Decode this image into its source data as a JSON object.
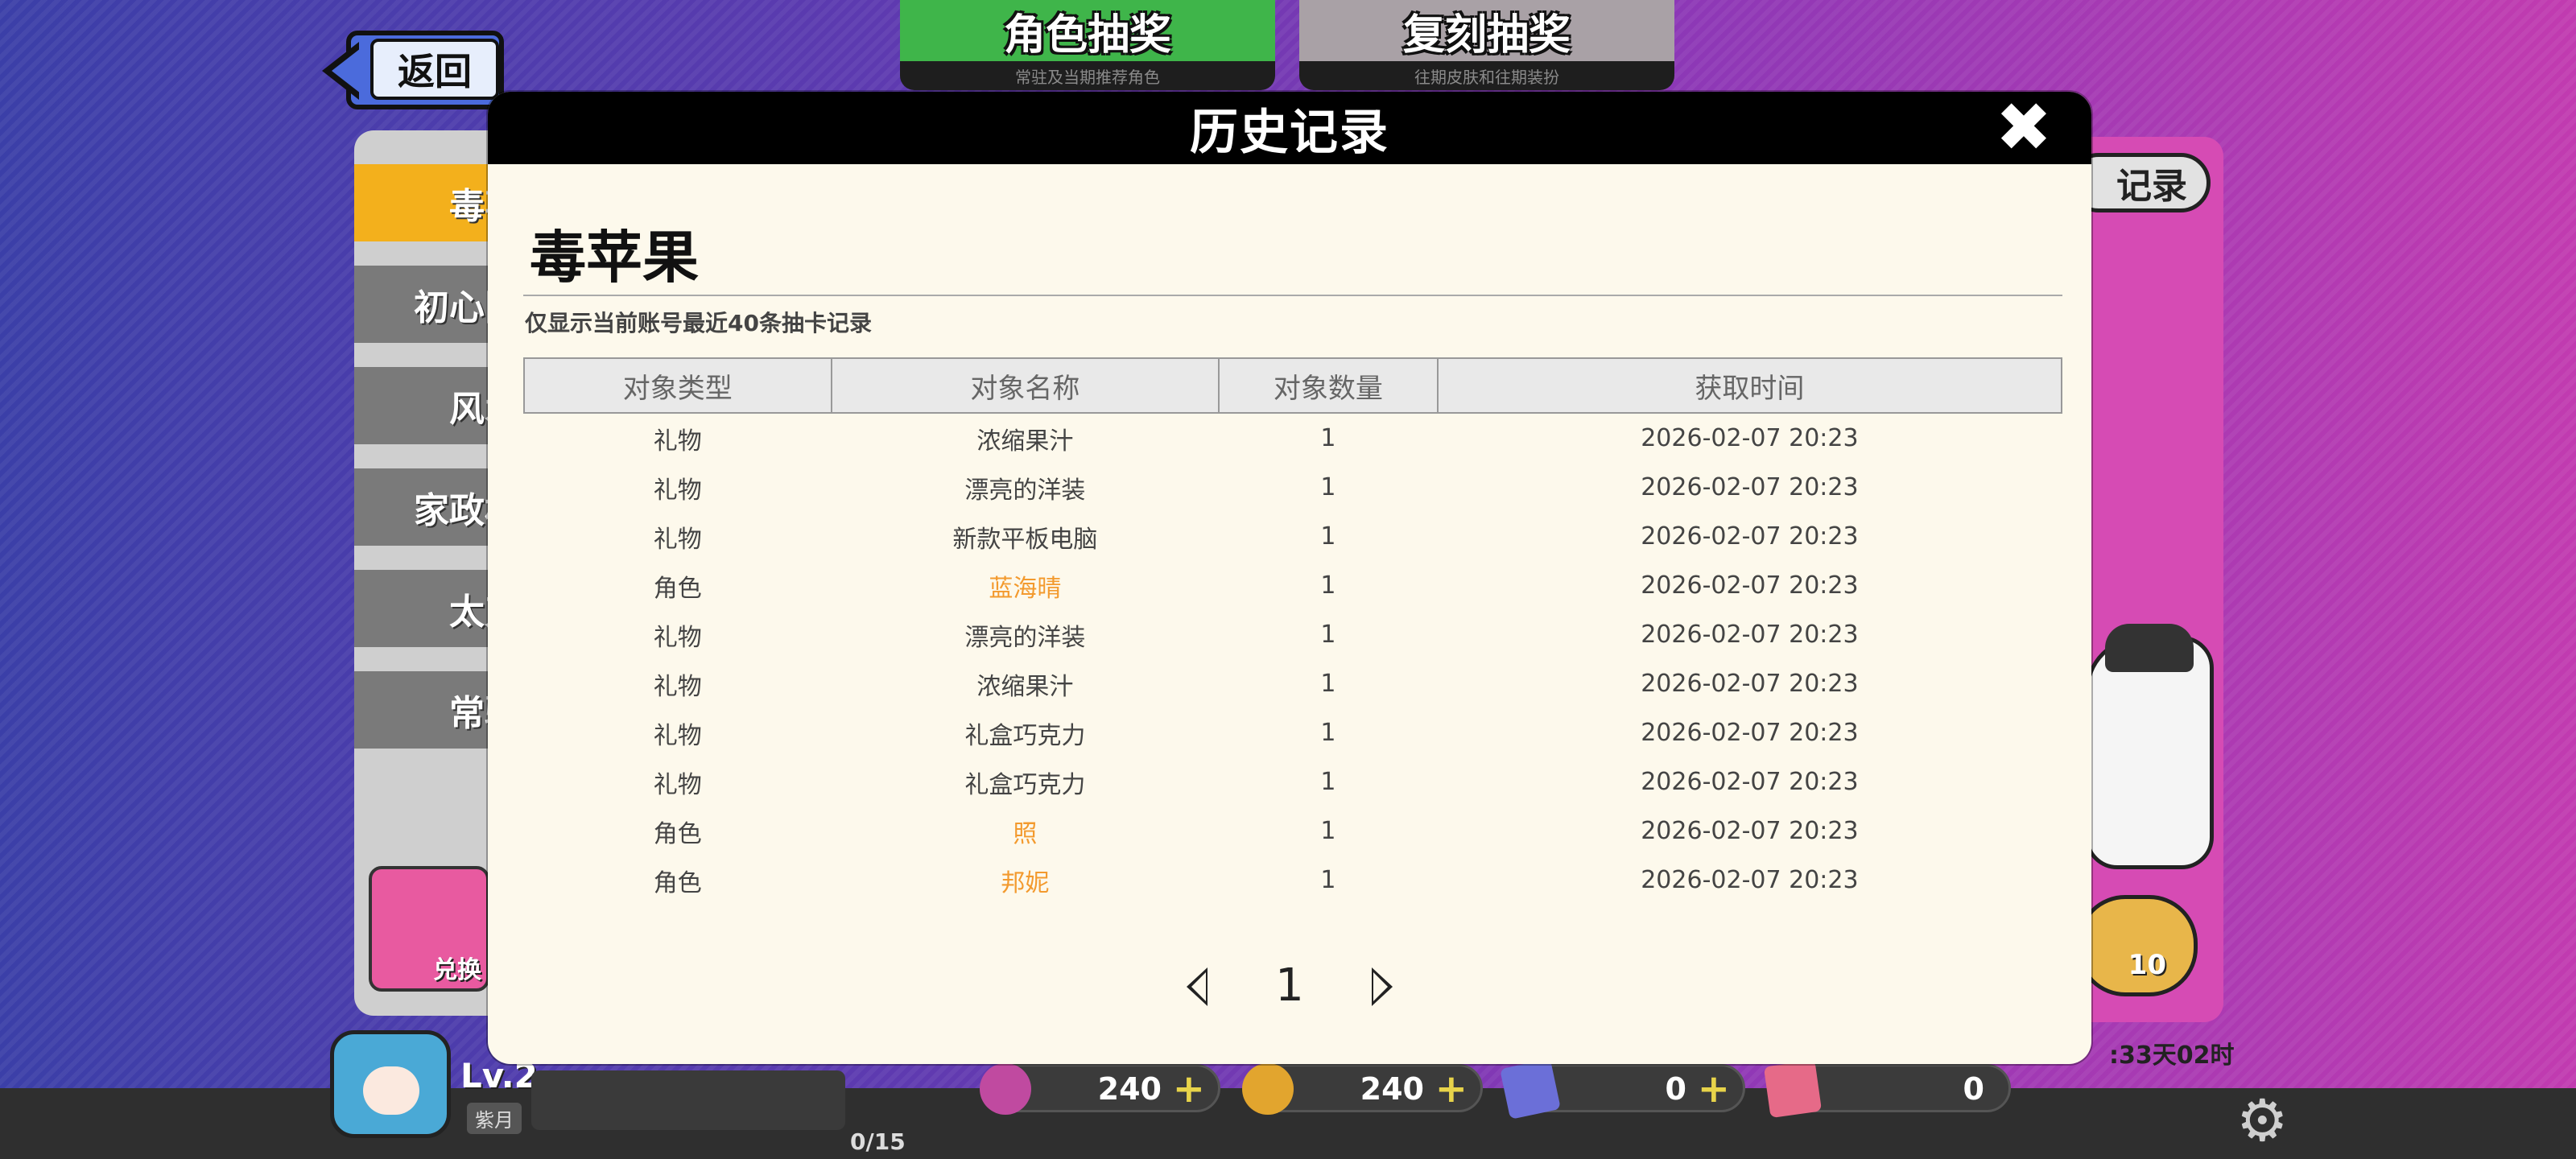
{
  "back_label": "返回",
  "tabs": [
    {
      "title": "角色抽奖",
      "subtitle": "常驻及当期推荐角色"
    },
    {
      "title": "复刻抽奖",
      "subtitle": "往期皮肤和往期装扮"
    }
  ],
  "sidebar": [
    {
      "label": "毒苹"
    },
    {
      "label": "初心阵"
    },
    {
      "label": "风水"
    },
    {
      "label": "家政机"
    },
    {
      "label": "太刀"
    },
    {
      "label": "常驻"
    }
  ],
  "exchange_label": "兑换",
  "right_record_label": "记录",
  "draw_ten_count": "10",
  "timer_text": ":33天02时",
  "player": {
    "level": "Lv.2",
    "tag": "紫月",
    "xp": "0/15"
  },
  "currencies": [
    {
      "icon": "disc-pink-icon",
      "value": "240",
      "plus": "+"
    },
    {
      "icon": "disc-gold-icon",
      "value": "240",
      "plus": "+"
    },
    {
      "icon": "ticket-blue-icon",
      "value": "0",
      "plus": "+"
    },
    {
      "icon": "ticket-pink-icon",
      "value": "0"
    }
  ],
  "modal": {
    "title": "历史记录",
    "close_glyph": "✖",
    "pool_name": "毒苹果",
    "notice": "仅显示当前账号最近40条抽卡记录",
    "columns": [
      "对象类型",
      "对象名称",
      "对象数量",
      "获取时间"
    ],
    "rows": [
      {
        "type": "礼物",
        "name": "浓缩果汁",
        "qty": "1",
        "time": "2026-02-07 20:23"
      },
      {
        "type": "礼物",
        "name": "漂亮的洋装",
        "qty": "1",
        "time": "2026-02-07 20:23"
      },
      {
        "type": "礼物",
        "name": "新款平板电脑",
        "qty": "1",
        "time": "2026-02-07 20:23"
      },
      {
        "type": "角色",
        "name": "蓝海晴",
        "qty": "1",
        "time": "2026-02-07 20:23"
      },
      {
        "type": "礼物",
        "name": "漂亮的洋装",
        "qty": "1",
        "time": "2026-02-07 20:23"
      },
      {
        "type": "礼物",
        "name": "浓缩果汁",
        "qty": "1",
        "time": "2026-02-07 20:23"
      },
      {
        "type": "礼物",
        "name": "礼盒巧克力",
        "qty": "1",
        "time": "2026-02-07 20:23"
      },
      {
        "type": "礼物",
        "name": "礼盒巧克力",
        "qty": "1",
        "time": "2026-02-07 20:23"
      },
      {
        "type": "角色",
        "name": "照",
        "qty": "1",
        "time": "2026-02-07 20:23"
      },
      {
        "type": "角色",
        "name": "邦妮",
        "qty": "1",
        "time": "2026-02-07 20:23"
      }
    ],
    "page": "1"
  },
  "colors": {
    "highlight_character": "#f39a2e",
    "header_bg": "#000000",
    "modal_bg": "#fdf9ec"
  }
}
